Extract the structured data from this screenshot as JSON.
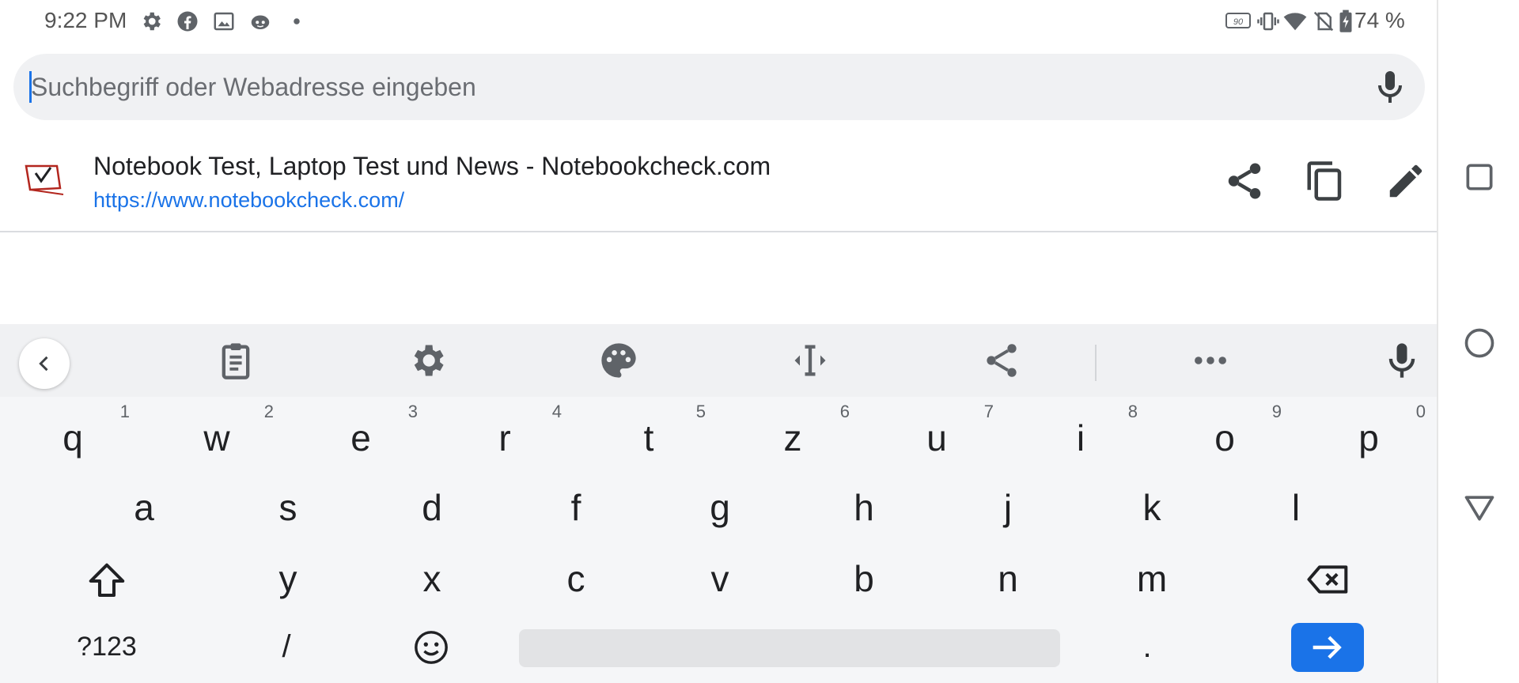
{
  "status_bar": {
    "time": "9:22 PM",
    "battery_percent": "74 %",
    "left_icons": [
      "gear-icon",
      "facebook-icon",
      "image-icon",
      "reddit-icon",
      "dot-icon"
    ],
    "right_icons": [
      "refresh-rate-icon",
      "vibrate-icon",
      "wifi-icon",
      "no-sim-icon",
      "battery-icon"
    ],
    "refresh_rate_label": "90"
  },
  "url_bar": {
    "placeholder": "Suchbegriff oder Webadresse eingeben",
    "value": "",
    "mic_icon": "mic-icon"
  },
  "suggestion": {
    "title": "Notebook Test, Laptop Test und News - Notebookcheck.com",
    "url": "https://www.notebookcheck.com/",
    "actions": [
      "share-icon",
      "copy-icon",
      "edit-icon"
    ]
  },
  "keyboard": {
    "toolbar": [
      "back-icon",
      "clipboard-icon",
      "settings-icon",
      "palette-icon",
      "cursor-move-icon",
      "share-icon",
      "more-icon",
      "mic-icon"
    ],
    "row1": [
      {
        "key": "q",
        "hint": "1"
      },
      {
        "key": "w",
        "hint": "2"
      },
      {
        "key": "e",
        "hint": "3"
      },
      {
        "key": "r",
        "hint": "4"
      },
      {
        "key": "t",
        "hint": "5"
      },
      {
        "key": "z",
        "hint": "6"
      },
      {
        "key": "u",
        "hint": "7"
      },
      {
        "key": "i",
        "hint": "8"
      },
      {
        "key": "o",
        "hint": "9"
      },
      {
        "key": "p",
        "hint": "0"
      }
    ],
    "row2": [
      "a",
      "s",
      "d",
      "f",
      "g",
      "h",
      "j",
      "k",
      "l"
    ],
    "row3": [
      "y",
      "x",
      "c",
      "v",
      "b",
      "n",
      "m"
    ],
    "row4": {
      "symbols": "?123",
      "slash": "/",
      "period": "."
    },
    "accent_color": "#1a73e8"
  },
  "nav_bar": {
    "buttons": [
      "recents-icon",
      "home-icon",
      "back-icon"
    ]
  }
}
